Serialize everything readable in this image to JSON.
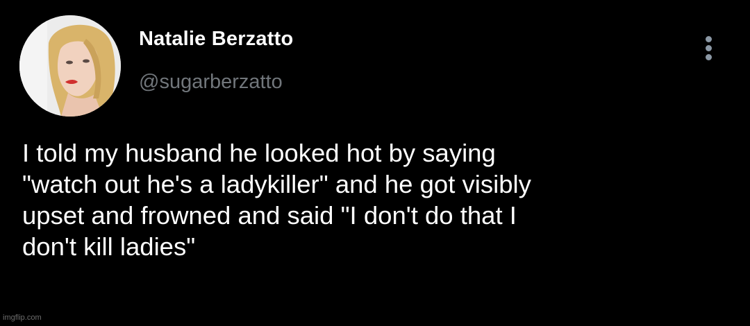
{
  "tweet": {
    "author": {
      "display_name": "Natalie Berzatto",
      "handle": "@sugarberzatto",
      "avatar_icon": "profile-photo"
    },
    "text": "I told my husband he looked hot by saying\n\"watch out he's a ladykiller\" and he got visibly\nupset and frowned and said \"I don't do that I\ndon't kill ladies\"",
    "more_icon": "vertical-ellipsis-icon"
  },
  "watermark": "imgflip.com",
  "colors": {
    "background": "#000000",
    "text": "#ffffff",
    "secondary_text": "#71767b",
    "icon": "#8b98a5"
  }
}
